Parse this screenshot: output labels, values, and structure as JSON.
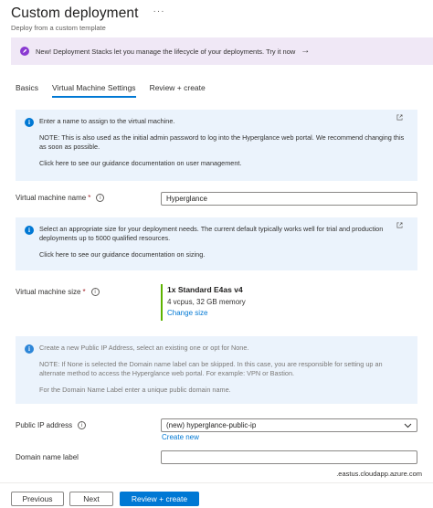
{
  "header": {
    "title": "Custom deployment",
    "more": "···",
    "subtitle": "Deploy from a custom template"
  },
  "banner": {
    "text": "New! Deployment Stacks let you manage the lifecycle of your deployments. Try it now",
    "arrow": "→"
  },
  "tabs": [
    {
      "label": "Basics"
    },
    {
      "label": "Virtual Machine Settings"
    },
    {
      "label": "Review + create"
    }
  ],
  "info_vm_name": {
    "line1": "Enter a name to assign to the virtual machine.",
    "line2": "NOTE: This is also used as the initial admin password to log into the Hyperglance web portal. We recommend changing this as soon as possible.",
    "line3": "Click here to see our guidance documentation on user management."
  },
  "vm_name": {
    "label": "Virtual machine name",
    "required": "*",
    "value": "Hyperglance"
  },
  "info_vm_size": {
    "line1": "Select an appropriate size for your deployment needs.  The current default typically works well for trial and production deployments up to 5000 qualified resources.",
    "line2": "Click here to see our guidance documentation on sizing."
  },
  "vm_size": {
    "label": "Virtual machine size",
    "required": "*",
    "name": "1x Standard E4as v4",
    "spec": "4 vcpus, 32 GB memory",
    "change": "Change size"
  },
  "info_ip": {
    "line1": "Create a new Public IP Address, select an existing one or opt for None.",
    "line2": "NOTE: If None is selected the Domain name label can be skipped. In this case, you are responsible for setting up an alternate method to access the Hyperglance web portal. For example: VPN or Bastion.",
    "line3": "For the Domain Name Label enter a unique public domain name."
  },
  "public_ip": {
    "label": "Public IP address",
    "value": "(new) hyperglance-public-ip",
    "create": "Create new"
  },
  "domain": {
    "label": "Domain name label",
    "value": "",
    "suffix": ".eastus.cloudapp.azure.com"
  },
  "footer": {
    "previous": "Previous",
    "next": "Next",
    "review": "Review + create"
  }
}
